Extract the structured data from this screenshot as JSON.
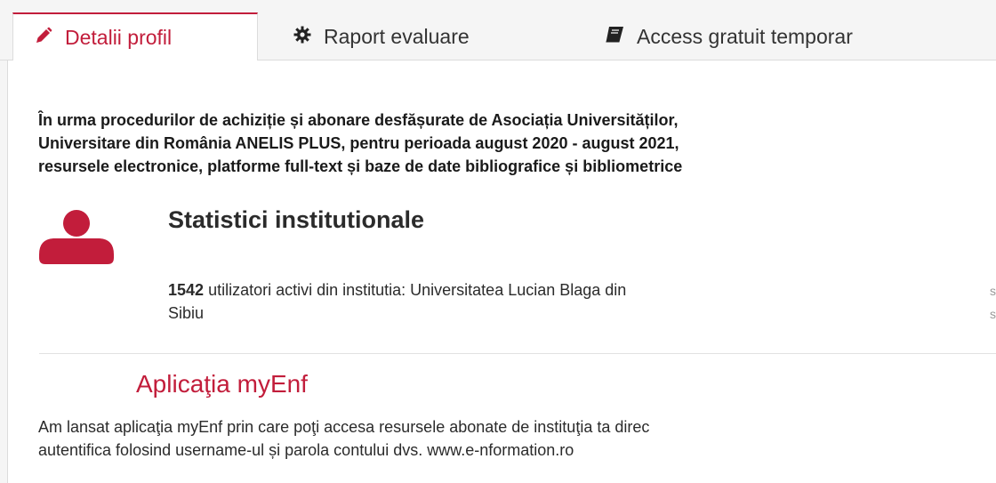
{
  "tabs": {
    "profile": {
      "label": "Detalii profil",
      "icon": "pencil-icon"
    },
    "report": {
      "label": "Raport evaluare",
      "icon": "gear-icon"
    },
    "access": {
      "label": "Access gratuit temporar",
      "icon": "book-icon"
    }
  },
  "intro": {
    "line1": "În urma procedurilor de achiziție și abonare desfășurate de Asociația Universităților,",
    "line2": "Universitare din România ANELIS PLUS, pentru perioada august 2020 - august 2021,",
    "line3": "resursele electronice, platforme full-text și baze de date bibliografice și bibliometrice"
  },
  "stats": {
    "icon": "user-icon",
    "title": "Statistici institutionale",
    "count": "1542",
    "text_line1": "utilizatori activi din institutia: Universitatea Lucian Blaga din",
    "text_line2": "Sibiu",
    "edge_mark1": "s",
    "edge_mark2": "s"
  },
  "app": {
    "title": "Aplicaţia myEnf",
    "line1": "Am lansat aplicaţia myEnf prin care poţi accesa resursele abonate de instituţia ta direc",
    "line2": "autentifica folosind username-ul și parola contului dvs. www.e-nformation.ro"
  },
  "colors": {
    "accent": "#c21d3b"
  }
}
